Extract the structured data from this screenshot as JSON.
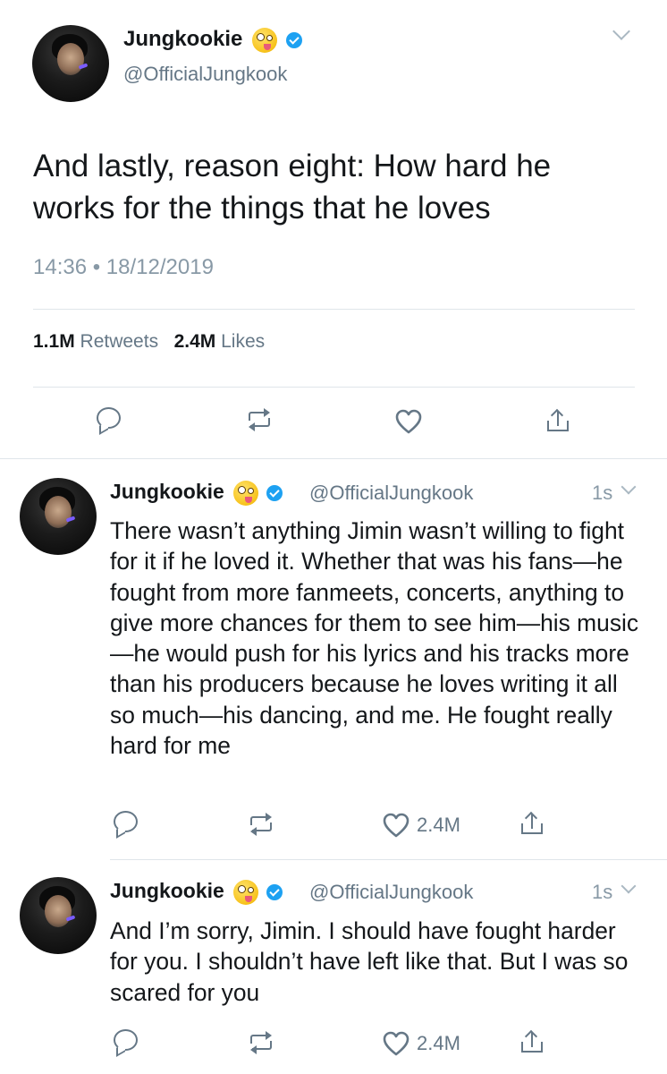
{
  "main_tweet": {
    "display_name": "Jungkookie",
    "handle": "@OfficialJungkook",
    "text": "And lastly, reason eight: How hard he works for the things that he loves",
    "timestamp": "14:36 • 18/12/2019",
    "retweets_count": "1.1M",
    "retweets_label": "Retweets",
    "likes_count": "2.4M",
    "likes_label": "Likes"
  },
  "replies": [
    {
      "display_name": "Jungkookie",
      "handle": "@OfficialJungkook",
      "time": "1s",
      "text": "There wasn’t anything Jimin wasn’t willing to fight for it if he loved it. Whether that was his fans—he fought from more fanmeets, concerts, anything to give more chances for them to see him—his music—he would push for his lyrics and his tracks more than his producers because he loves writing it all so much—his dancing, and me. He fought really hard for me",
      "likes": "2.4M"
    },
    {
      "display_name": "Jungkookie",
      "handle": "@OfficialJungkook",
      "time": "1s",
      "text": "And I’m sorry, Jimin. I should have fought harder for you. I shouldn’t have left like that. But I was so scared for you",
      "likes": "2.4M"
    }
  ],
  "icons": {
    "reply": "reply-icon",
    "retweet": "retweet-icon",
    "like": "heart-icon",
    "share": "share-icon",
    "verified": "verified-badge-icon",
    "emoji": "zany-face-emoji-icon",
    "more": "chevron-down-icon"
  },
  "colors": {
    "text": "#14171a",
    "secondary": "#657786",
    "verified": "#1da1f2",
    "divider": "#dfe5ea"
  }
}
